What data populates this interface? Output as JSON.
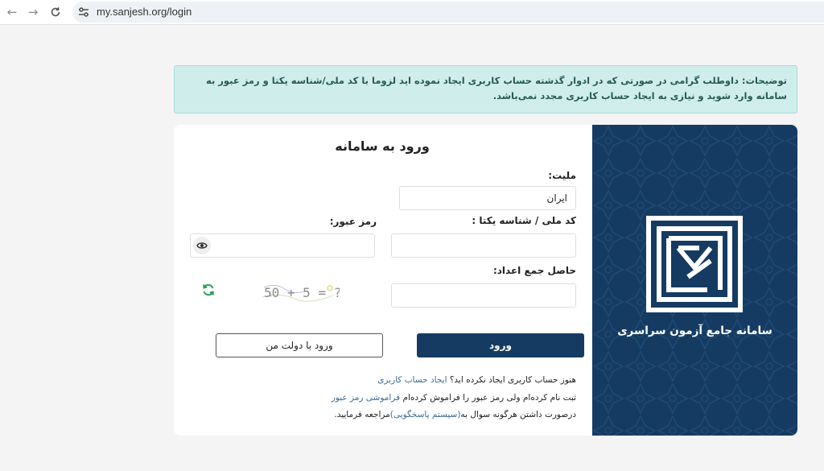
{
  "browser": {
    "url": "my.sanjesh.org/login"
  },
  "notice": {
    "text": "توضیحات: داوطلب گرامی در صورتی که در ادوار گذشته حساب کاربری ایجاد نموده اید لزوما با کد ملی/شناسه یکتا و رمز عبور به سامانه وارد شوید و نیازی به ایجاد حساب کاربری مجدد نمی‌باشد."
  },
  "form": {
    "title": "ورود به سامانه",
    "nationality_label": "ملیت:",
    "nationality_value": "ایران",
    "national_code_label": "کد ملی / شناسه یکتا :",
    "national_code_value": "",
    "password_label": "رمز عبور:",
    "password_value": "",
    "sum_label": "حاصل جمع اعداد:",
    "sum_value": "",
    "captcha_text": "50 + 5 = ?",
    "login_button": "ورود",
    "gov_login_button": "ورود با دولت من"
  },
  "help": {
    "no_account_text": "هنوز حساب کاربری ایجاد نکرده اید؟",
    "create_account_link": "ایجاد حساب کاربری",
    "forgot_text": "ثبت نام کرده‌ام ولی رمز عبور را فراموش کرده‌ام",
    "forgot_link": "فراموشی رمز عبور",
    "question_prefix": "درصورت داشتن هرگونه سوال به",
    "support_link": "(سیستم پاسخگویی)",
    "question_suffix": "مراجعه فرمایید."
  },
  "brand": {
    "title": "سامانه جامع آزمون سراسری"
  },
  "colors": {
    "primary": "#163b62",
    "notice_bg": "#cfeeeb",
    "notice_text": "#275a55",
    "link": "#3d6a8f",
    "refresh_icon": "#2e9e5b"
  },
  "icons": {
    "back": "arrow-left-icon",
    "forward": "arrow-right-icon",
    "reload": "reload-icon",
    "site_settings": "tune-icon",
    "show_password": "eye-icon",
    "refresh_captcha": "refresh-icon"
  }
}
